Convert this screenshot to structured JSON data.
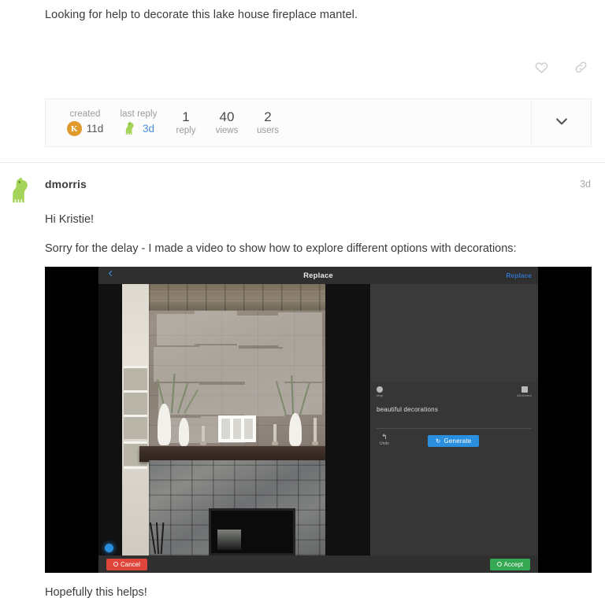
{
  "topic": {
    "excerpt": "Looking for help to decorate this lake house fireplace mantel.",
    "actions": {
      "like": "like-icon",
      "share": "link-icon"
    }
  },
  "stats": {
    "created_label": "created",
    "created_value": "11d",
    "created_avatar_initial": "K",
    "last_reply_label": "last reply",
    "last_reply_value": "3d",
    "replies_count": "1",
    "replies_label": "reply",
    "views_count": "40",
    "views_label": "views",
    "users_count": "2",
    "users_label": "users",
    "expand_icon": "chevron-down-icon"
  },
  "reply": {
    "author": "dmorris",
    "time": "3d",
    "paragraph1": "Hi Kristie!",
    "paragraph2": "Sorry for the delay - I made a video to show how to explore different options with decorations:",
    "paragraph3": "Hopefully this helps!"
  },
  "video": {
    "app": {
      "header": {
        "back_icon": "chevron-left-icon",
        "title": "Replace",
        "right_action": "Replace"
      },
      "panel": {
        "tool_left_label": "Map",
        "tool_right_label": "Attributes",
        "prompt_value": "beautiful decorations",
        "undo_label": "Undo",
        "undo_icon": "undo-icon",
        "generate_label": "Generate",
        "generate_icon": "refresh-icon"
      },
      "footer": {
        "cancel_label": "Cancel",
        "accept_label": "Accept"
      }
    }
  },
  "colors": {
    "accent_blue": "#2b8fe0",
    "cancel_red": "#e0453c",
    "accept_green": "#36a853",
    "avatar_orange": "#e09a2b",
    "link_blue": "#4a90d9",
    "text": "#3c3c3c",
    "muted": "#9a9a9a"
  }
}
